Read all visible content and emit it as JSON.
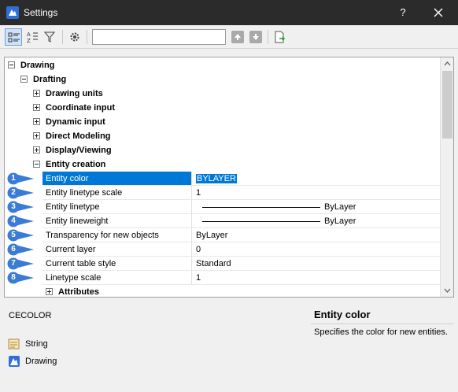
{
  "window": {
    "title": "Settings",
    "help_label": "?"
  },
  "colors": {
    "titlebar": "#2b2b2b",
    "selection": "#0078d7",
    "callout": "#3a7bd5"
  },
  "toolbar": {
    "buttons": [
      "categorized-view-icon",
      "alphabetical-view-icon",
      "filter-icon",
      "settings-gear-icon"
    ],
    "search": {
      "value": "",
      "placeholder": ""
    },
    "nav": [
      "arrow-up-icon",
      "arrow-down-icon",
      "export-icon"
    ]
  },
  "tree": {
    "root": {
      "label": "Drawing",
      "expanded": true
    },
    "drafting": {
      "label": "Drafting",
      "expanded": true
    },
    "categories": [
      {
        "label": "Drawing units",
        "expanded": false
      },
      {
        "label": "Coordinate input",
        "expanded": false
      },
      {
        "label": "Dynamic input",
        "expanded": false
      },
      {
        "label": "Direct Modeling",
        "expanded": false
      },
      {
        "label": "Display/Viewing",
        "expanded": false
      },
      {
        "label": "Entity creation",
        "expanded": true
      }
    ],
    "properties": [
      {
        "callout": "1",
        "name": "Entity color",
        "value": "BYLAYER",
        "selected": true
      },
      {
        "callout": "2",
        "name": "Entity linetype scale",
        "value": "1"
      },
      {
        "callout": "3",
        "name": "Entity linetype",
        "value": "ByLayer",
        "line": true
      },
      {
        "callout": "4",
        "name": "Entity lineweight",
        "value": "ByLayer",
        "line": true
      },
      {
        "callout": "5",
        "name": "Transparency for new objects",
        "value": "ByLayer"
      },
      {
        "callout": "6",
        "name": "Current layer",
        "value": "0"
      },
      {
        "callout": "7",
        "name": "Current table style",
        "value": "Standard"
      },
      {
        "callout": "8",
        "name": "Linetype scale",
        "value": "1"
      }
    ],
    "attributes": {
      "label": "Attributes",
      "expanded": false
    }
  },
  "info": {
    "system_variable": "CECOLOR",
    "type": "String",
    "scope": "Drawing",
    "description_title": "Entity color",
    "description": "Specifies the color for new entities."
  }
}
